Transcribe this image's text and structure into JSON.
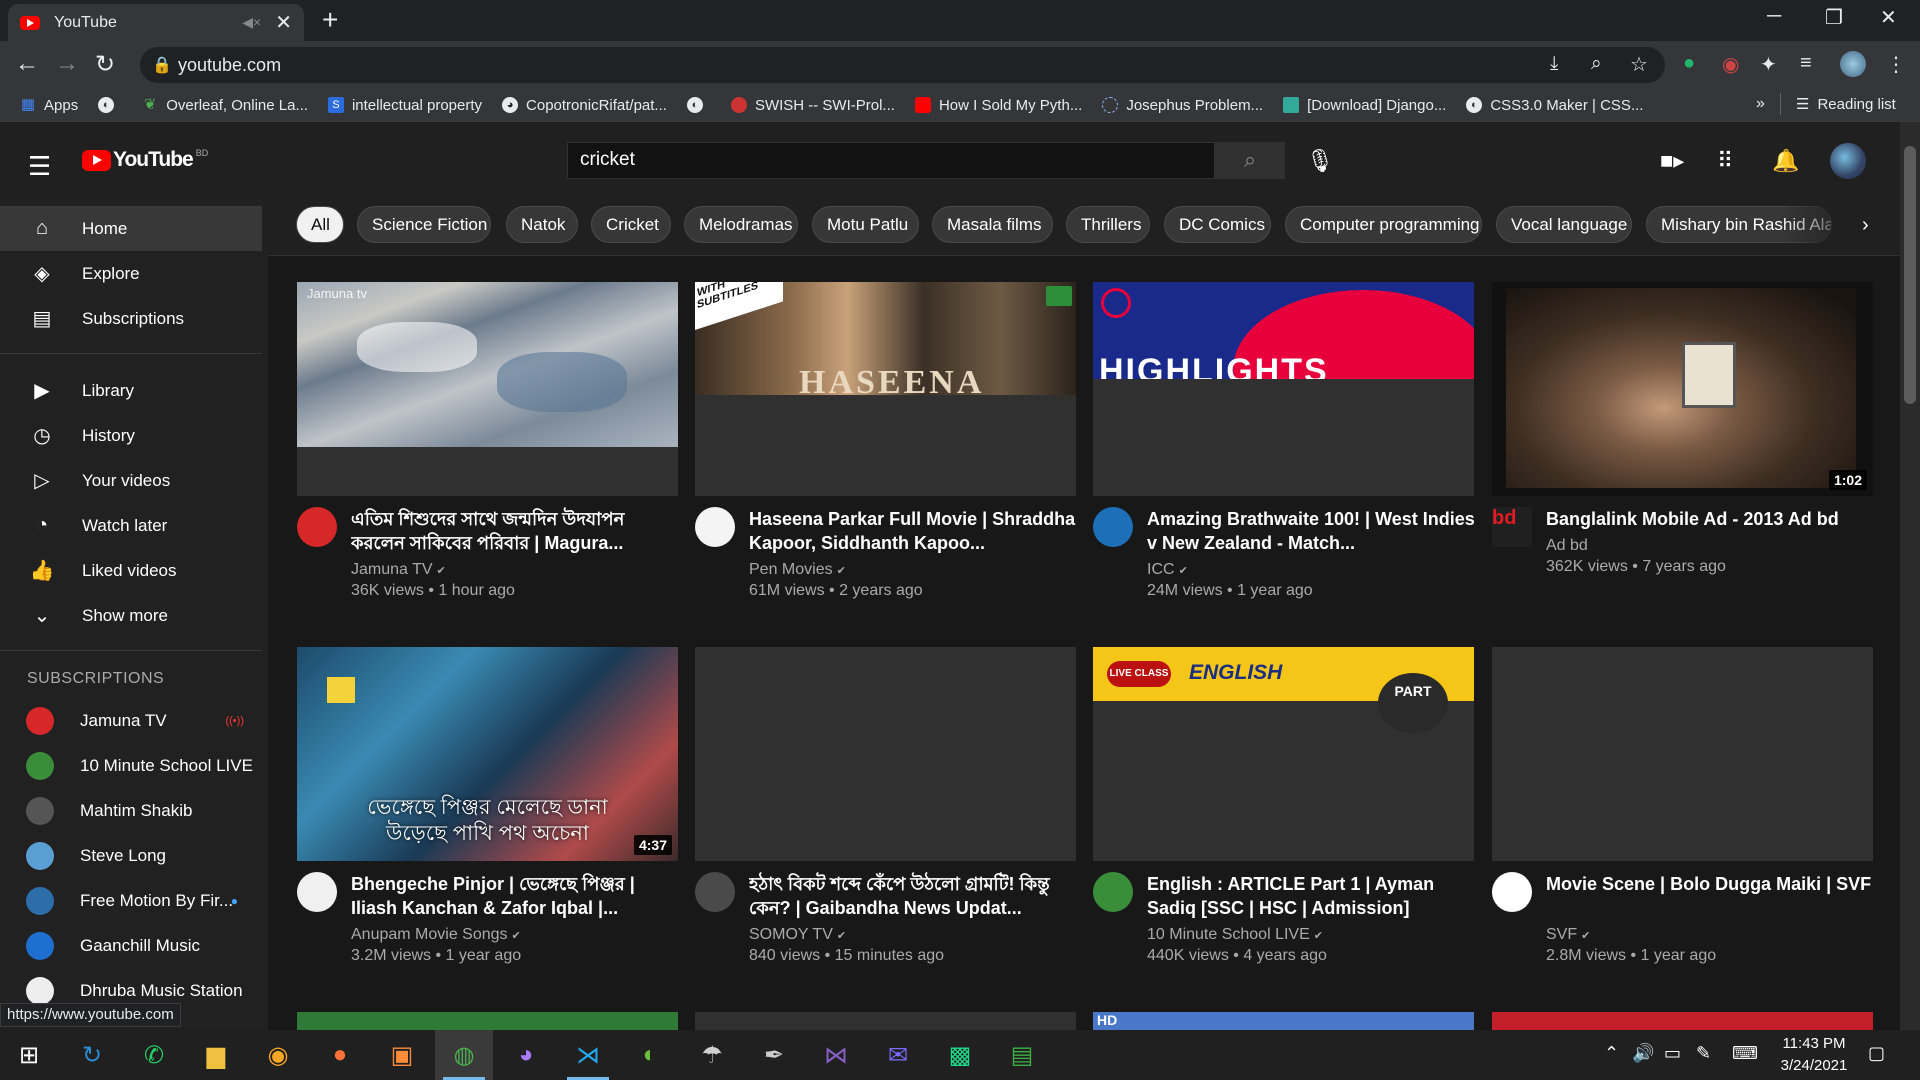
{
  "browser": {
    "tab_title": "YouTube",
    "url": "youtube.com",
    "bookmarks": [
      "Apps",
      "Overleaf, Online La...",
      "intellectual property",
      "CopotronicRifat/pat...",
      "SWISH -- SWI-Prol...",
      "How I Sold My Pyth...",
      "Josephus Problem...",
      "[Download] Django...",
      "CSS3.0 Maker | CSS..."
    ],
    "bookmarks_more": "»",
    "reading_list": "Reading list",
    "status_url": "https://www.youtube.com"
  },
  "header": {
    "logo_text": "YouTube",
    "country_code": "BD",
    "search_value": "cricket"
  },
  "sidebar": {
    "main": [
      {
        "label": "Home",
        "icon": "home-icon"
      },
      {
        "label": "Explore",
        "icon": "compass-icon"
      },
      {
        "label": "Subscriptions",
        "icon": "subscriptions-icon"
      }
    ],
    "library": [
      {
        "label": "Library",
        "icon": "library-icon"
      },
      {
        "label": "History",
        "icon": "history-icon"
      },
      {
        "label": "Your videos",
        "icon": "your-videos-icon"
      },
      {
        "label": "Watch later",
        "icon": "clock-icon"
      },
      {
        "label": "Liked videos",
        "icon": "thumbs-up-icon"
      },
      {
        "label": "Show more",
        "icon": "chevron-down-icon"
      }
    ],
    "subs_heading": "SUBSCRIPTIONS",
    "subscriptions": [
      {
        "label": "Jamuna TV",
        "color": "#d62828",
        "status": "live"
      },
      {
        "label": "10 Minute School LIVE",
        "color": "#3a8d3a",
        "status": ""
      },
      {
        "label": "Mahtim Shakib",
        "color": "#555555",
        "status": ""
      },
      {
        "label": "Steve Long",
        "color": "#5a9fd4",
        "status": ""
      },
      {
        "label": "Free Motion By Fir...",
        "color": "#2d6ea8",
        "status": "new"
      },
      {
        "label": "Gaanchill Music",
        "color": "#1f6fd0",
        "status": ""
      },
      {
        "label": "Dhruba Music Station",
        "color": "#eeeeee",
        "status": ""
      }
    ]
  },
  "chips": [
    "All",
    "Science Fiction",
    "Natok",
    "Cricket",
    "Melodramas",
    "Motu Patlu",
    "Masala films",
    "Thrillers",
    "DC Comics",
    "Computer programming",
    "Vocal language",
    "Mishary bin Rashid Alafasy"
  ],
  "videos": [
    {
      "title": "এতিম শিশুদের সাথে জন্মদিন উদযাপন করলেন সাকিবের পরিবার | Magura...",
      "channel": "Jamuna TV",
      "verified": true,
      "meta": "36K views • 1 hour ago",
      "duration": "",
      "avatar_color": "#d62828"
    },
    {
      "title": "Haseena Parkar Full Movie | Shraddha Kapoor, Siddhanth Kapoo...",
      "channel": "Pen Movies",
      "verified": true,
      "meta": "61M views • 2 years ago",
      "duration": "",
      "avatar_color": "#f4f4f4"
    },
    {
      "title": "Amazing Brathwaite 100! | West Indies v New Zealand - Match...",
      "channel": "ICC",
      "verified": true,
      "meta": "24M views • 1 year ago",
      "duration": "",
      "avatar_color": "#1d6fb8"
    },
    {
      "title": "Banglalink Mobile Ad - 2013 Ad bd",
      "channel": "Ad bd",
      "verified": false,
      "meta": "362K views • 7 years ago",
      "duration": "1:02",
      "avatar_color": "#202020"
    },
    {
      "title": "Bhengeche Pinjor | ভেঙ্গেছে পিঞ্জর | Iliash Kanchan & Zafor Iqbal |...",
      "channel": "Anupam Movie Songs",
      "verified": true,
      "meta": "3.2M views • 1 year ago",
      "duration": "4:37",
      "avatar_color": "#f0f0f0"
    },
    {
      "title": "হঠাৎ বিকট শব্দে কেঁপে উঠলো গ্রামটি! কিন্তু কেন? | Gaibandha News Updat...",
      "channel": "SOMOY TV",
      "verified": true,
      "meta": "840 views • 15 minutes ago",
      "duration": "",
      "avatar_color": "#4a4a4a"
    },
    {
      "title": "English : ARTICLE Part 1 | Ayman Sadiq [SSC | HSC | Admission]",
      "channel": "10 Minute School LIVE",
      "verified": true,
      "meta": "440K views • 4 years ago",
      "duration": "",
      "avatar_color": "#3a8d3a"
    },
    {
      "title": "Movie Scene | Bolo Dugga Maiki | SVF",
      "channel": "SVF",
      "verified": true,
      "meta": "2.8M views • 1 year ago",
      "duration": "",
      "avatar_color": "#ffffff"
    }
  ],
  "thumb_text": {
    "haseena": "HASEENA",
    "subtitles_ribbon": "WITH SUBTITLES",
    "highlights": "HIGHLIGHTS",
    "bangla_caption_1": "ভেঙ্গেছে পিঞ্জর মেলেছে ডানা",
    "bangla_caption_2": "উড়েছে পাখি পথ অচেনা",
    "live_class": "LIVE CLASS",
    "english": "ENGLISH",
    "part": "PART",
    "jamuna_watermark": "Jamuna tv",
    "hd": "HD"
  },
  "taskbar": {
    "time": "11:43 PM",
    "date": "3/24/2021"
  }
}
